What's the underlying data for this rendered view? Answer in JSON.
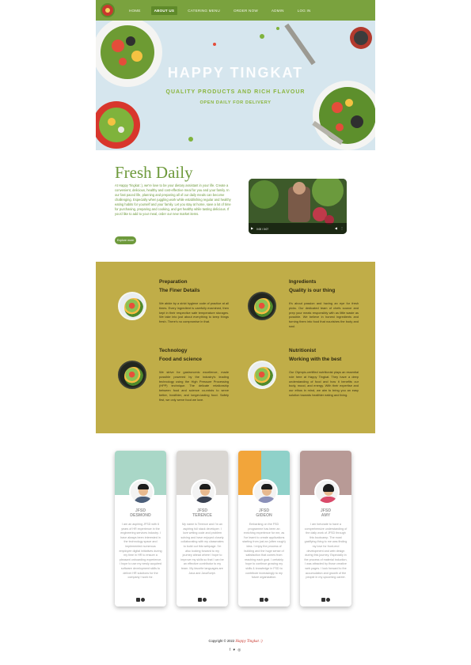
{
  "nav": {
    "items": [
      {
        "label": "HOME",
        "active": false
      },
      {
        "label": "ABOUT US",
        "active": true
      },
      {
        "label": "CATERING MENU",
        "active": false
      },
      {
        "label": "ORDER NOW",
        "active": false
      },
      {
        "label": "ADMIN",
        "active": false
      },
      {
        "label": "LOG IN",
        "active": false
      }
    ]
  },
  "hero": {
    "title": "HAPPY TINGKAT",
    "subtitle": "QUALITY PRODUCTS AND RICH FLAVOUR",
    "tagline": "OPEN DAILY FOR DELIVERY"
  },
  "fresh": {
    "title": "Fresh Daily",
    "body": "At Happy Tingkat :), we're love to be your dietary assistant in your life. Create a convenient, delicious, healthy and cost-effective meal for you and your family. In our fast paced life, planning and preparing all of our daily meals can become challenging. Especially when juggling work while establishing regular and healthy eating habits for yourself and your family. Let you stay at home, save a lot of time for purchasing, preparing and cooking, and get healthy while tasting delicious. If you'd like to add to your meal, order our new market items.",
    "button": "Explore more",
    "video_time": "0:00 / 0:07"
  },
  "features": [
    {
      "title": "Preparation",
      "subtitle": "The Finer Details",
      "body": "We abide by a strict hygiene code of practice at all times. Every ingredient is carefully examined, then kept in their respective safe temperature storages. We take into just about everything to keep things fresh. There's no compromise in that."
    },
    {
      "title": "Ingredients",
      "subtitle": "Quality is our thing",
      "body": "It's about passion and having an eye for fresh picks. Our dedicated team of chefs source and prep your meals responsibly with as little waste as possible. We believe in honest ingredients and turning them into food that nourishes the body and soul."
    },
    {
      "title": "Technology",
      "subtitle": "Food and science",
      "body": "We strive for gastronomic excellence, made possible powered by the industry's leading technology using the High Pressure Processing (HPP) technique. The delicate relationship between food and science co-exists to serve better, healthier, and longer-lasting food. Safety first, we only serve food we love."
    },
    {
      "title": "Nutritionist",
      "subtitle": "Working with the best",
      "body": "Our Olympic-certified nutritionist plays an essential role here at Happy Tingkat. They have a deep understanding of food and how it benefits our body, mood, and energy. With their expertise and our ethos in mind, we aim to bring you an easy solution towards healthier eating and living."
    }
  ],
  "team": [
    {
      "line1": "JFSD",
      "line2": "DESMOND",
      "body": "I am an aspiring JFSD with 6 years of HR experience in the engineering services industry. I have always been interested in the technology space and implemented numerous employee digital initiatives during my time in HR to ensure a pleasant onboarding experience. I hope to use my newly acquired software development skills to deliver HR solutions for the company I work for."
    },
    {
      "line1": "JFSD",
      "line2": "TERENCE",
      "body": "My name is Terence and I'm an aspiring full stack developer. I love writing code and problem solving and have enjoyed closely collaborating with my classmates to build out this webpage. I'm also looking forward to my journey ahead where I hope to improve my skills so that I can be an effective contributor to my team. My favorite languages are Java and JavaScript."
    },
    {
      "line1": "JFSD",
      "line2": "GIDEON",
      "body": "Embarking on the FSD programme has been an enriching experience for me, as I've learnt to create applications starting from just an (often rough) idea. I enjoy the process of building and the huge sense of satisfaction that comes from reaching each goal. I certainly hope to continue growing my skills & knowledge in FSD to contribute increasingly to my future organization."
    },
    {
      "line1": "JFSD",
      "line2": "AMY",
      "body": "I am fortunate to have a comprehensive understanding of the daily work of JFSD through this bootcamp. The most gratifying thing to me was finding my love for front-end development and web design during this journey. Especially in the process of material induction, I was attracted by those creative web pages. I look forward to the accumulation and growth of the people in my upcoming career."
    }
  ],
  "footer": {
    "copyright": "Copyright © 2022",
    "brand": "Happy Tingkat :)",
    "social": "f ♥ ◎"
  }
}
